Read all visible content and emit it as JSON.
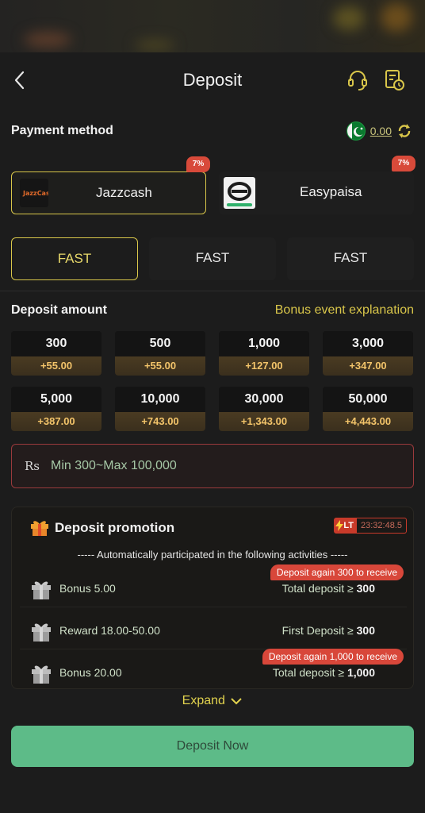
{
  "header": {
    "title": "Deposit"
  },
  "payment": {
    "label": "Payment method",
    "balance": "0.00",
    "methods": [
      {
        "name": "Jazzcash",
        "badge": "7%",
        "logo_text": "JazzCash"
      },
      {
        "name": "Easypaisa",
        "badge": "7%"
      }
    ],
    "channels": [
      "FAST",
      "FAST",
      "FAST"
    ]
  },
  "deposit": {
    "label": "Deposit amount",
    "bonus_link": "Bonus event explanation",
    "amounts": [
      {
        "value": "300",
        "bonus": "+55.00"
      },
      {
        "value": "500",
        "bonus": "+55.00"
      },
      {
        "value": "1,000",
        "bonus": "+127.00"
      },
      {
        "value": "3,000",
        "bonus": "+347.00"
      },
      {
        "value": "5,000",
        "bonus": "+387.00"
      },
      {
        "value": "10,000",
        "bonus": "+743.00"
      },
      {
        "value": "30,000",
        "bonus": "+1,343.00"
      },
      {
        "value": "50,000",
        "bonus": "+4,443.00"
      }
    ],
    "currency": "Rs",
    "placeholder": "Min 300~Max 100,000"
  },
  "promotion": {
    "title": "Deposit promotion",
    "lt_tag": "LT",
    "timer": "23:32:48.5",
    "auto_text": "----- Automatically participated in the following activities -----",
    "activities": [
      {
        "name": "Bonus 5.00",
        "cond_text": "Total deposit ≥",
        "cond_value": "300",
        "tip": "Deposit again 300 to receive"
      },
      {
        "name": "Reward 18.00-50.00",
        "cond_text": "First Deposit ≥",
        "cond_value": "300",
        "tip": ""
      },
      {
        "name": "Bonus 20.00",
        "cond_text": "Total deposit ≥",
        "cond_value": "1,000",
        "tip": "Deposit again 1,000 to receive"
      }
    ],
    "expand_label": "Expand"
  },
  "deposit_button": "Deposit Now",
  "colors": {
    "accent": "#d9c64a",
    "bonus_gold": "#f3c46a",
    "badge_red": "#d84a3a",
    "button_green": "#5dbb88"
  }
}
